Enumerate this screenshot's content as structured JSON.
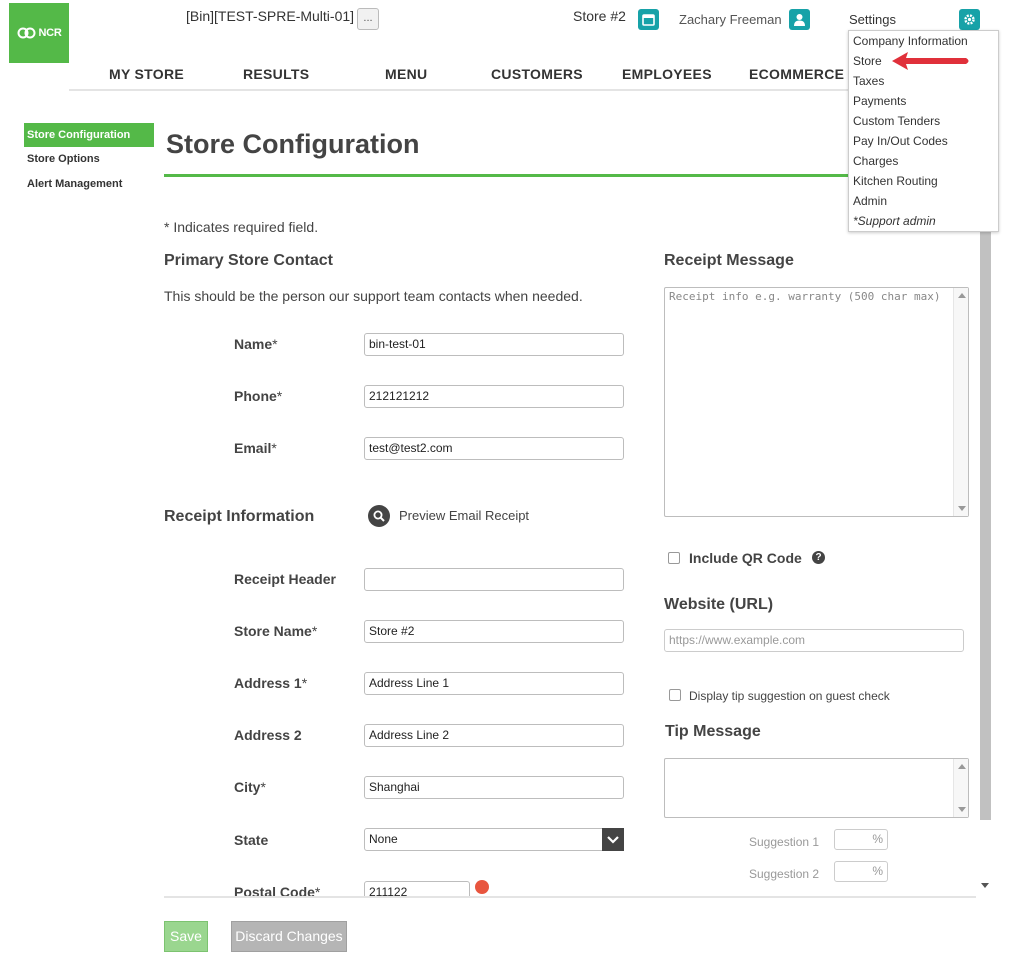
{
  "brand": {
    "logo_text": "NCR"
  },
  "header": {
    "org_name": "[Bin][TEST-SPRE-Multi-01]",
    "more_label": "...",
    "store_selector": "Store #2",
    "user_name": "Zachary Freeman",
    "settings_label": "Settings"
  },
  "nav": {
    "items": [
      "MY STORE",
      "RESULTS",
      "MENU",
      "CUSTOMERS",
      "EMPLOYEES",
      "ECOMMERCE"
    ]
  },
  "settings_menu": {
    "items": [
      "Company Information",
      "Store",
      "Taxes",
      "Payments",
      "Custom Tenders",
      "Pay In/Out Codes",
      "Charges",
      "Kitchen Routing",
      "Admin",
      "*Support admin"
    ]
  },
  "sidebar": {
    "items": [
      "Store Configuration",
      "Store Options",
      "Alert Management"
    ]
  },
  "page": {
    "title": "Store Configuration",
    "required_note": "* Indicates required field."
  },
  "primary_contact": {
    "heading": "Primary Store Contact",
    "description": "This should be the person our support team contacts when needed.",
    "name_label": "Name",
    "name_value": "bin-test-01",
    "phone_label": "Phone",
    "phone_value": "212121212",
    "email_label": "Email",
    "email_value": "test@test2.com"
  },
  "receipt_info": {
    "heading": "Receipt Information",
    "preview_label": "Preview Email Receipt",
    "header_label": "Receipt Header",
    "header_value": "",
    "store_name_label": "Store Name",
    "store_name_value": "Store #2",
    "address1_label": "Address 1",
    "address1_value": "Address Line 1",
    "address2_label": "Address 2",
    "address2_value": "Address Line 2",
    "city_label": "City",
    "city_value": "Shanghai",
    "state_label": "State",
    "state_value": "None",
    "postal_label": "Postal Code",
    "postal_value": "211122"
  },
  "required_marker": "*",
  "receipt_message": {
    "heading": "Receipt Message",
    "placeholder": "Receipt info e.g. warranty (500 char max)",
    "qr_label": "Include QR Code",
    "help_glyph": "?"
  },
  "website": {
    "heading": "Website (URL)",
    "placeholder": "https://www.example.com"
  },
  "tip": {
    "checkbox_label": "Display tip suggestion on guest check",
    "heading": "Tip Message",
    "suggestion1_label": "Suggestion 1",
    "suggestion2_label": "Suggestion 2",
    "percent_symbol": "%"
  },
  "actions": {
    "save_label": "Save",
    "discard_label": "Discard Changes"
  },
  "colors": {
    "brand_green": "#54b948",
    "teal": "#17a2a8",
    "arrow_red": "#e0303a"
  }
}
